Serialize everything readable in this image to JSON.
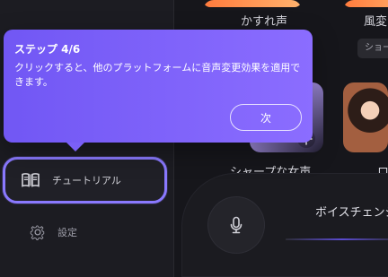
{
  "tooltip": {
    "step": "ステップ 4/6",
    "message": "クリックすると、他のプラットフォームに音声変更効果を適用できます。",
    "next_button": "次"
  },
  "sidebar": {
    "items": [
      {
        "label": "チュートリアル",
        "icon": "book-icon"
      },
      {
        "label": "設定",
        "icon": "gear-icon"
      }
    ]
  },
  "cards": [
    {
      "title": "かすれ声"
    },
    {
      "title": "風変"
    }
  ],
  "card_chip": "ショー",
  "thumbnails": [
    {
      "label": "シャープな女声"
    },
    {
      "label": "ロ"
    }
  ],
  "voice_changer": {
    "title": "ボイスチェンジャ"
  },
  "colors": {
    "accent": "#7d67ff",
    "background": "#18181c",
    "panel": "#1c1c22",
    "text": "#ffffff"
  }
}
